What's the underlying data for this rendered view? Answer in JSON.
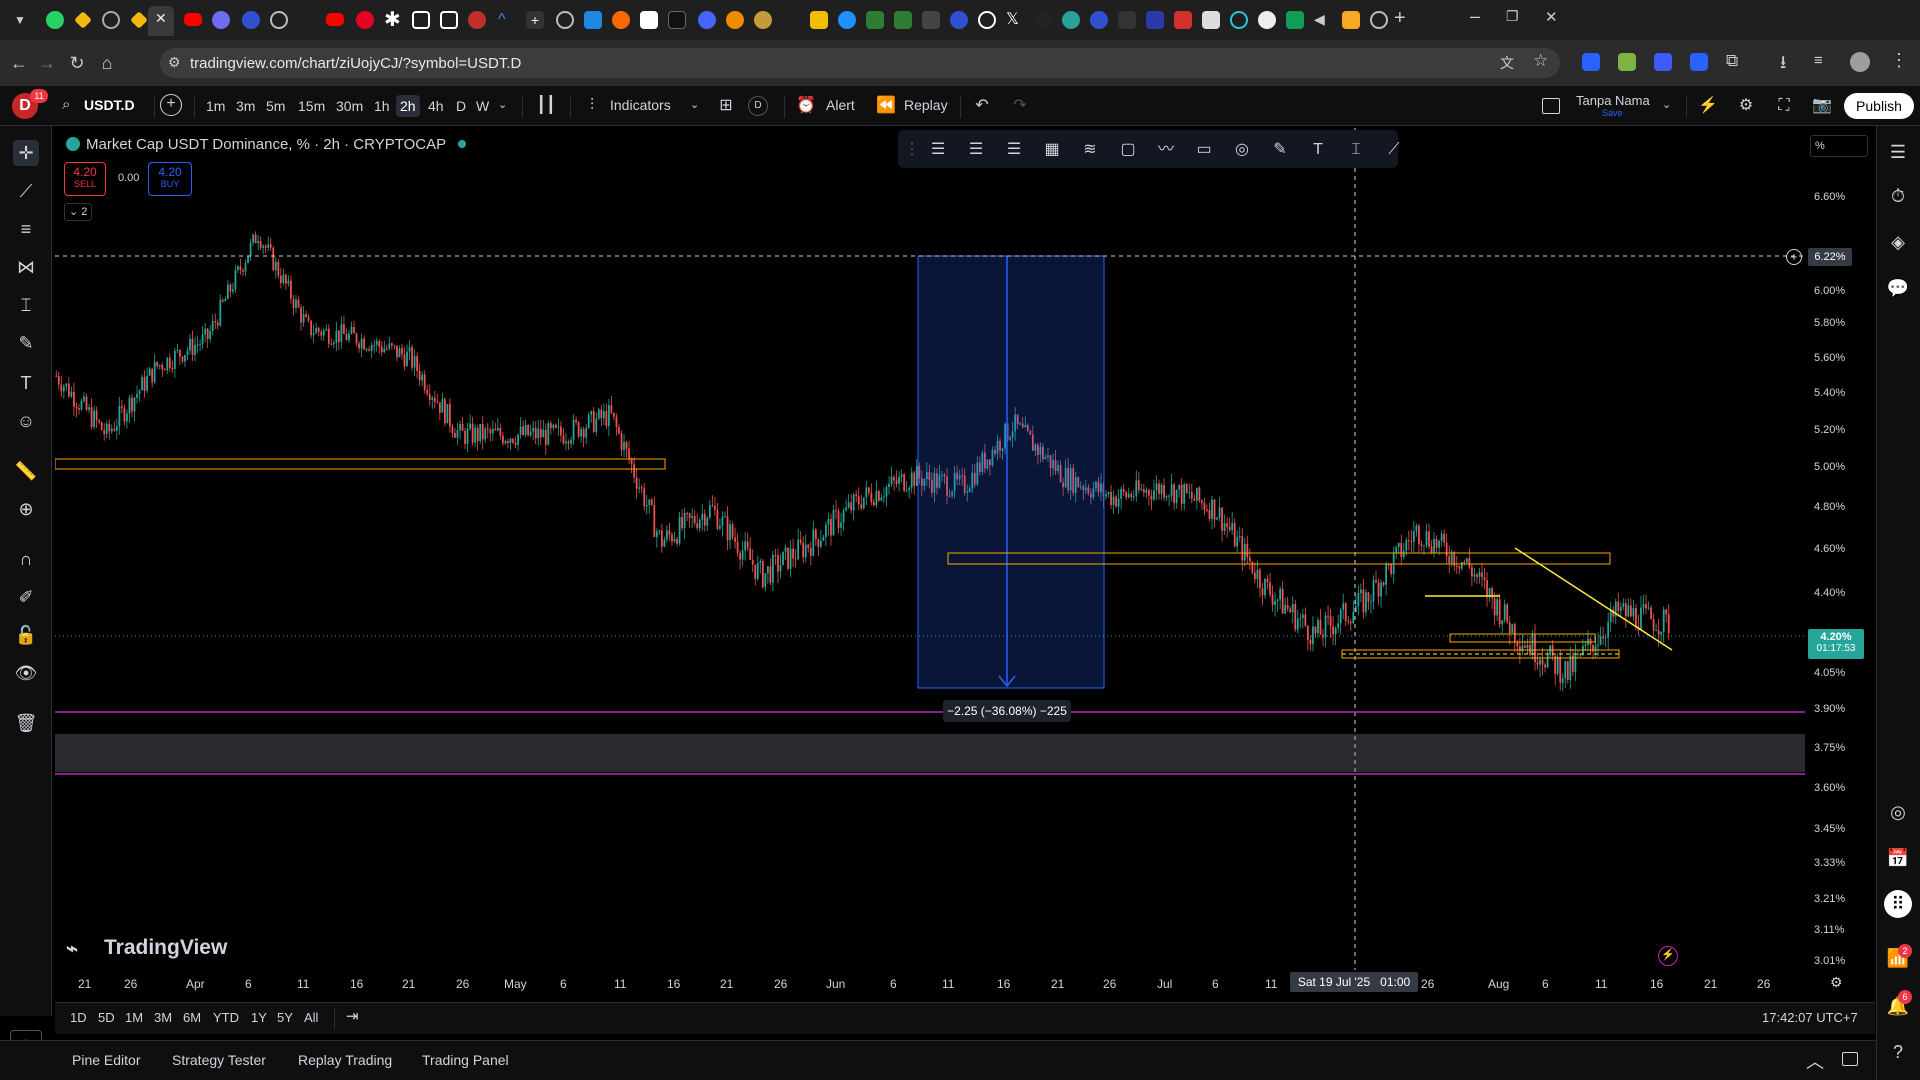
{
  "browser": {
    "url": "tradingview.com/chart/ziUojyCJ/?symbol=USDT.D"
  },
  "toolbar": {
    "avatar_letter": "D",
    "avatar_badge": "11",
    "symbol": "USDT.D",
    "timeframes": [
      "1m",
      "3m",
      "5m",
      "15m",
      "30m",
      "1h",
      "2h",
      "4h",
      "D",
      "W"
    ],
    "active_timeframe": "2h",
    "indicators_label": "Indicators",
    "alert_label": "Alert",
    "replay_label": "Replay",
    "layout_name": "Tanpa Nama",
    "layout_status": "Save",
    "publish_label": "Publish",
    "d_label": "D"
  },
  "legend": {
    "title": "Market Cap USDT Dominance, % · 2h · CRYPTOCAP",
    "sell_price": "4.20",
    "sell_label": "SELL",
    "spread": "0.00",
    "buy_price": "4.20",
    "buy_label": "BUY",
    "collapse_count": "2"
  },
  "price_scale": {
    "unit_label": "%",
    "ticks": [
      "6.60%",
      "6.00%",
      "5.80%",
      "5.60%",
      "5.40%",
      "5.20%",
      "5.00%",
      "4.80%",
      "4.60%",
      "4.40%",
      "4.05%",
      "3.90%",
      "3.75%",
      "3.60%",
      "3.45%",
      "3.33%",
      "3.21%",
      "3.11%",
      "3.01%"
    ],
    "crosshair_price": "6.22%",
    "current_price": "4.20%",
    "countdown": "01:17:53"
  },
  "time_scale": {
    "ticks": [
      "21",
      "26",
      "Apr",
      "6",
      "11",
      "16",
      "21",
      "26",
      "May",
      "6",
      "11",
      "16",
      "21",
      "26",
      "Jun",
      "6",
      "11",
      "16",
      "21",
      "26",
      "Jul",
      "6",
      "11",
      "26",
      "Aug",
      "6",
      "11",
      "16",
      "21",
      "26"
    ],
    "crosshair_label": "Sat 19 Jul '25   01:00"
  },
  "measure": {
    "label": "−2.25 (−36.08%) −225"
  },
  "watermark": "TradingView",
  "range_bar": {
    "ranges": [
      "1D",
      "5D",
      "1M",
      "3M",
      "6M",
      "YTD",
      "1Y",
      "5Y",
      "All"
    ],
    "clock": "17:42:07 UTC+7"
  },
  "bottom_panel": {
    "tabs": [
      "Pine Editor",
      "Strategy Tester",
      "Replay Trading",
      "Trading Panel"
    ]
  },
  "right_badges": {
    "notifications": "2",
    "alerts": "6"
  },
  "colors": {
    "up": "#26a69a",
    "down": "#ef5350",
    "box_orange": "#f7a600",
    "trend_yellow": "#ffeb3b",
    "magenta_line": "#c025c0",
    "measure_blue": "#2962ff",
    "accent": "#2962ff"
  },
  "chart_data": {
    "type": "candlestick",
    "symbol": "USDT.D",
    "timeframe": "2h",
    "y_range": [
      3.0,
      6.7
    ],
    "x": [
      "Mar 21",
      "Mar 26",
      "Apr 1",
      "Apr 6",
      "Apr 8",
      "Apr 11",
      "Apr 16",
      "Apr 21",
      "Apr 26",
      "May 1",
      "May 6",
      "May 11",
      "May 16",
      "May 21",
      "May 26",
      "Jun 1",
      "Jun 6",
      "Jun 11",
      "Jun 16",
      "Jun 21",
      "Jun 26",
      "Jul 1",
      "Jul 6",
      "Jul 11",
      "Jul 16",
      "Jul 21",
      "Jul 26",
      "Aug 1",
      "Aug 6",
      "Aug 11",
      "Aug 14",
      "Aug 16",
      "Aug 17"
    ],
    "close": [
      5.35,
      5.05,
      5.4,
      5.55,
      6.15,
      5.6,
      5.55,
      5.45,
      5.05,
      5.05,
      5.05,
      5.15,
      4.55,
      4.7,
      4.4,
      4.55,
      4.75,
      4.85,
      4.8,
      5.1,
      4.85,
      4.75,
      4.8,
      4.7,
      4.35,
      4.15,
      4.3,
      4.6,
      4.45,
      4.15,
      4.0,
      4.25,
      4.2
    ]
  }
}
